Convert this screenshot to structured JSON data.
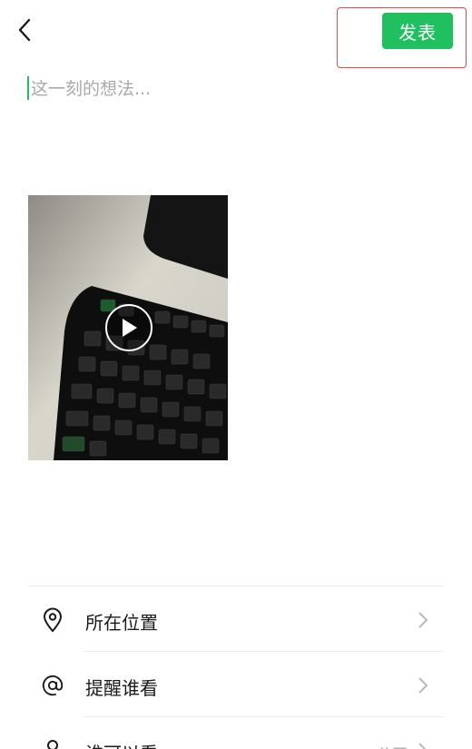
{
  "header": {
    "back_icon": "chevron-left-icon",
    "publish_label": "发表"
  },
  "composer": {
    "placeholder": "这一刻的想法..."
  },
  "media": {
    "type": "video",
    "play_icon": "play-icon"
  },
  "menu": {
    "items": [
      {
        "label": "所在位置",
        "value": "",
        "icon": "location-pin-icon"
      },
      {
        "label": "提醒谁看",
        "value": "",
        "icon": "at-sign-icon"
      },
      {
        "label": "谁可以看",
        "value": "公开",
        "icon": "person-icon"
      }
    ]
  },
  "colors": {
    "accent": "#20c060",
    "highlight": "#e04b4b"
  }
}
